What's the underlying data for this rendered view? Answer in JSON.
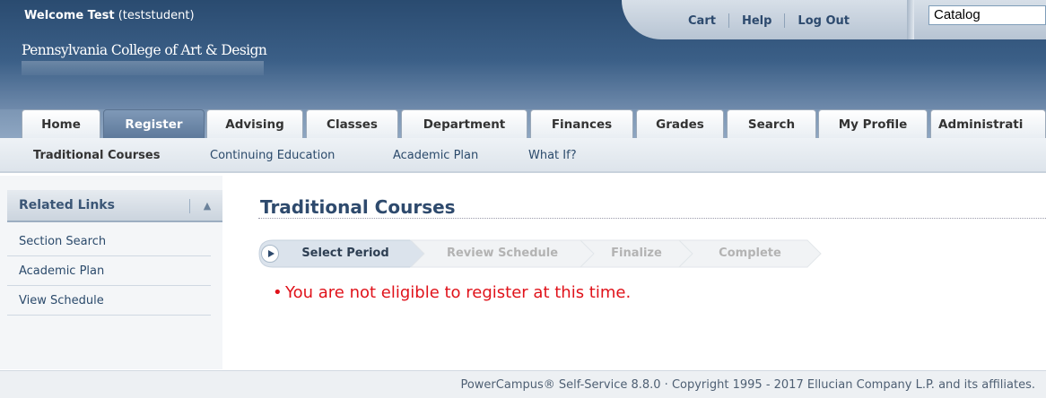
{
  "header": {
    "welcome_name": "Welcome Test",
    "welcome_user": "(teststudent)",
    "logo_text": "Pennsylvania College of Art & Design"
  },
  "toplinks": {
    "cart": "Cart",
    "help": "Help",
    "logout": "Log Out"
  },
  "catalog_select": {
    "value": "Catalog"
  },
  "tabs": [
    {
      "label": "Home"
    },
    {
      "label": "Register"
    },
    {
      "label": "Advising"
    },
    {
      "label": "Classes"
    },
    {
      "label": "Department"
    },
    {
      "label": "Finances"
    },
    {
      "label": "Grades"
    },
    {
      "label": "Search"
    },
    {
      "label": "My Profile"
    },
    {
      "label": "Administrati"
    }
  ],
  "active_tab": "Register",
  "subnav": [
    {
      "label": "Traditional Courses"
    },
    {
      "label": "Continuing Education"
    },
    {
      "label": "Academic Plan"
    },
    {
      "label": "What If?"
    }
  ],
  "sidebar": {
    "title": "Related Links",
    "links": [
      {
        "label": "Section Search"
      },
      {
        "label": "Academic Plan"
      },
      {
        "label": "View Schedule"
      }
    ]
  },
  "main": {
    "title": "Traditional Courses",
    "steps": [
      {
        "label": "Select Period"
      },
      {
        "label": "Review Schedule"
      },
      {
        "label": "Finalize"
      },
      {
        "label": "Complete"
      }
    ],
    "error": "You are not eligible to register at this time."
  },
  "footer": {
    "text": "PowerCampus® Self-Service 8.8.0 · Copyright 1995 - 2017 Ellucian Company L.P. and its affiliates."
  },
  "colors": {
    "header_blue": "#3b5f87",
    "accent_text": "#2e4a6d",
    "error_red": "#e0121a"
  }
}
